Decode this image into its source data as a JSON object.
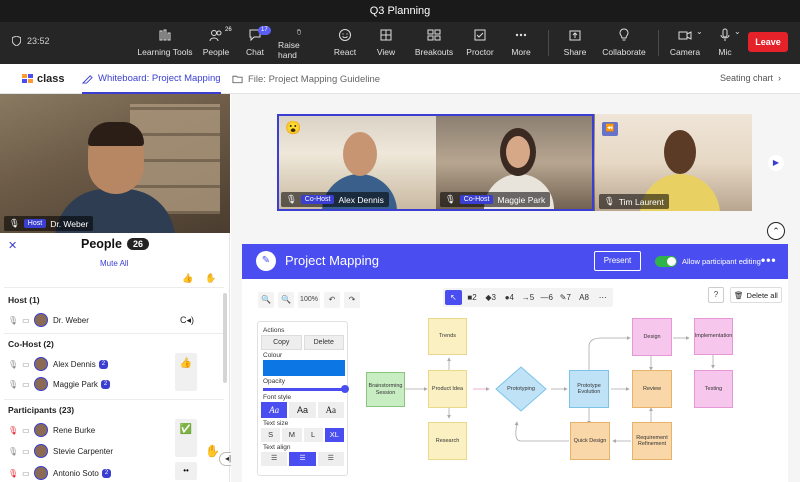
{
  "window": {
    "title": "Q3 Planning"
  },
  "toolbar": {
    "timer": "23:52",
    "buttons": [
      {
        "label": "Learning Tools",
        "icon": "learning-tools-icon"
      },
      {
        "label": "People",
        "icon": "people-icon",
        "badge": "26"
      },
      {
        "label": "Chat",
        "icon": "chat-icon",
        "badge": "17"
      },
      {
        "label": "Raise hand",
        "icon": "hand-icon"
      },
      {
        "label": "React",
        "icon": "smiley-icon"
      },
      {
        "label": "View",
        "icon": "view-icon"
      },
      {
        "label": "Breakouts",
        "icon": "breakouts-icon"
      },
      {
        "label": "Proctor",
        "icon": "proctor-icon"
      },
      {
        "label": "More",
        "icon": "more-icon"
      },
      {
        "label": "Share",
        "icon": "share-icon"
      },
      {
        "label": "Collaborate",
        "icon": "lightbulb-icon"
      },
      {
        "label": "Camera",
        "icon": "camera-icon"
      },
      {
        "label": "Mic",
        "icon": "mic-icon"
      }
    ],
    "leave_label": "Leave"
  },
  "subbar": {
    "logo": "class",
    "whiteboard_tab": "Whiteboard: Project Mapping",
    "file_tab": "File: Project Mapping Guideline",
    "seating": "Seating chart"
  },
  "host_video": {
    "role": "Host",
    "name": "Dr. Weber"
  },
  "people": {
    "title": "People",
    "count": "26",
    "mute_all": "Mute All",
    "sections": {
      "host": "Host (1)",
      "cohost": "Co-Host (2)",
      "participants": "Participants (23)"
    },
    "rows": [
      {
        "name": "Dr. Weber",
        "badge": "",
        "status": "C◂)"
      },
      {
        "name": "Alex Dennis",
        "badge": "2",
        "status": "👍"
      },
      {
        "name": "Maggie Park",
        "badge": "2",
        "status": ""
      },
      {
        "name": "Rene Burke",
        "badge": "",
        "status": "✅"
      },
      {
        "name": "Stevie Carpenter",
        "badge": "",
        "status": ""
      },
      {
        "name": "Antonio Soto",
        "badge": "2",
        "status": "••"
      }
    ]
  },
  "gallery": [
    {
      "name": "Alex Dennis",
      "role": "Co-Host"
    },
    {
      "name": "Maggie Park",
      "role": "Co-Host"
    },
    {
      "name": "Tim Laurent",
      "role": ""
    }
  ],
  "whiteboard": {
    "title": "Project Mapping",
    "present": "Present",
    "allow_editing": "Allow participant editing",
    "zoom": "100%",
    "delete_all": "Delete all",
    "tools": [
      "↖",
      "■2",
      "◆3",
      "●4",
      "→5",
      "—6",
      "✎7",
      "A8",
      "⋯"
    ],
    "props": {
      "actions_label": "Actions",
      "copy": "Copy",
      "delete": "Delete",
      "colour_label": "Colour",
      "opacity_label": "Opacity",
      "font_style_label": "Font style",
      "font_styles": [
        "Aa",
        "Aa",
        "Aa"
      ],
      "text_size_label": "Text size",
      "text_sizes": [
        "S",
        "M",
        "L",
        "XL"
      ],
      "text_align_label": "Text align",
      "colour": "#0b76e4"
    },
    "nodes": {
      "brainstorm": "Brainstorming Session",
      "trends": "Trends",
      "product_idea": "Product Idea",
      "research": "Research",
      "prototyping": "Prototyping",
      "prototype_evolution": "Prototype Evolution",
      "quick_design": "Quick Design",
      "design": "Design",
      "review": "Review",
      "requirement": "Requirement Refinement",
      "implementation": "Implementation",
      "testing": "Testing"
    }
  }
}
